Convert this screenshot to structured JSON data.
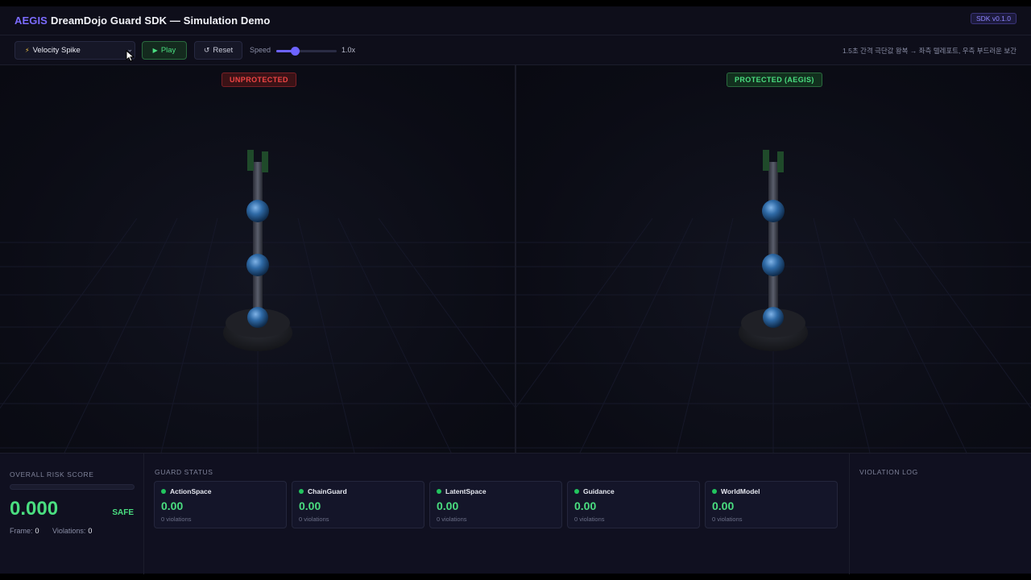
{
  "header": {
    "brand": "AEGIS",
    "title": "DreamDojo Guard SDK — Simulation Demo",
    "version_badge": "SDK v0.1.0"
  },
  "toolbar": {
    "scenario": {
      "icon": "bolt-icon",
      "selected": "Velocity Spike"
    },
    "play_label": "Play",
    "reset_label": "Reset",
    "speed_label": "Speed",
    "speed_value": "1.0x",
    "speed_fraction": 0.3,
    "hint": "1.5초 간격 극단값 왕복 → 좌측 텔레포트, 우측 부드러운 보간"
  },
  "viewports": {
    "left_tag": "UNPROTECTED",
    "right_tag": "PROTECTED (AEGIS)"
  },
  "risk": {
    "label": "OVERALL RISK SCORE",
    "score": "0.000",
    "state": "SAFE",
    "fill_fraction": 0,
    "frame_label": "Frame:",
    "frame_value": "0",
    "violations_label": "Violations:",
    "violations_value": "0"
  },
  "guard_status": {
    "label": "GUARD STATUS",
    "guards": [
      {
        "name": "ActionSpace",
        "value": "0.00",
        "violations": "0 violations"
      },
      {
        "name": "ChainGuard",
        "value": "0.00",
        "violations": "0 violations"
      },
      {
        "name": "LatentSpace",
        "value": "0.00",
        "violations": "0 violations"
      },
      {
        "name": "Guidance",
        "value": "0.00",
        "violations": "0 violations"
      },
      {
        "name": "WorldModel",
        "value": "0.00",
        "violations": "0 violations"
      }
    ]
  },
  "violation_log": {
    "label": "VIOLATION LOG"
  },
  "colors": {
    "accent": "#7c6cff",
    "safe": "#4ade80",
    "danger": "#ef4444"
  }
}
